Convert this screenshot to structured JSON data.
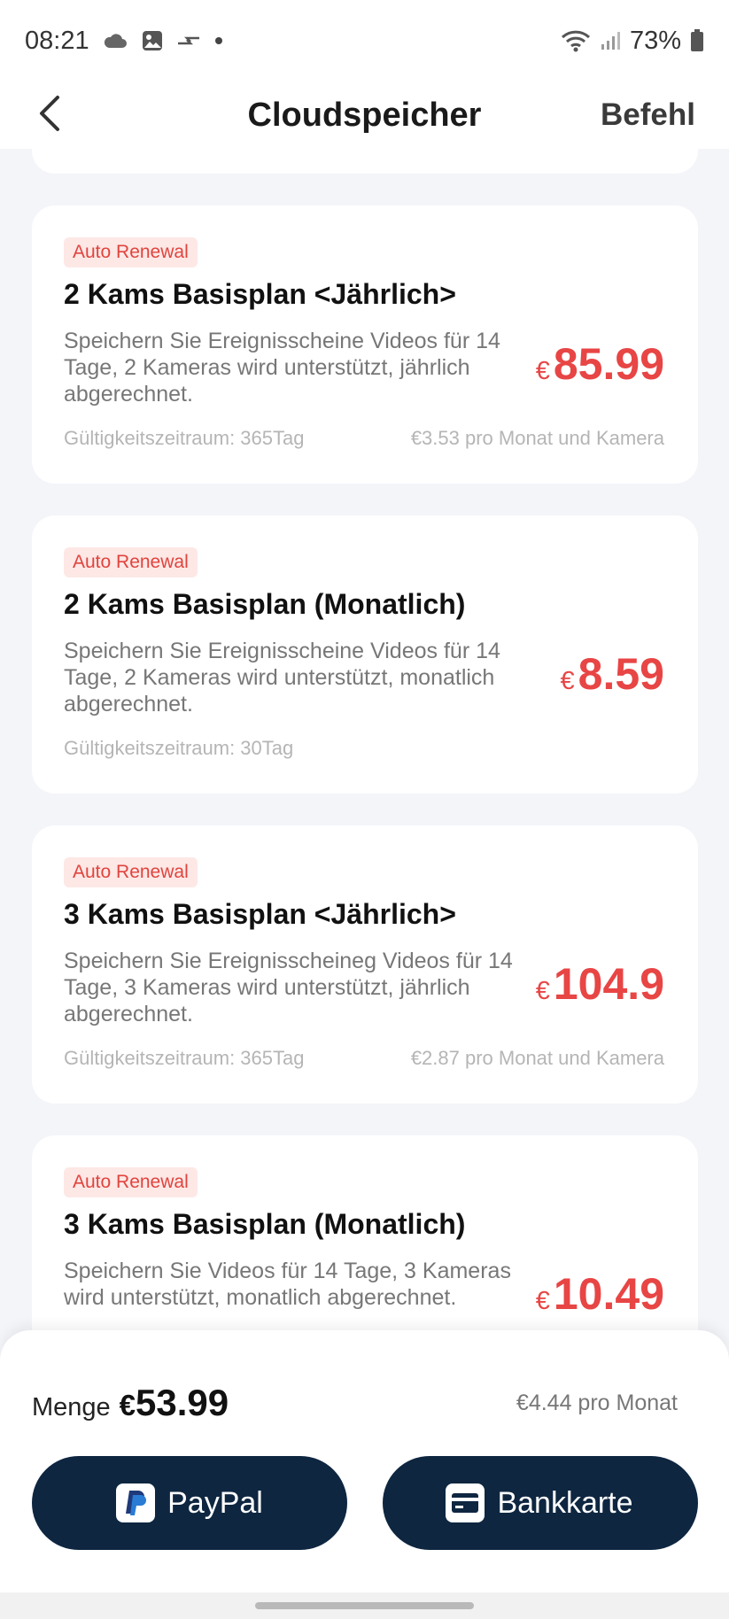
{
  "status_bar": {
    "time": "08:21",
    "battery": "73%",
    "icons_left": [
      "cloud-icon",
      "gallery-icon",
      "data-transfer-icon",
      "dot-icon"
    ],
    "icons_right": [
      "wifi-icon",
      "signal-icon",
      "battery-icon"
    ]
  },
  "header": {
    "title": "Cloudspeicher",
    "action_label": "Befehl",
    "back_icon": "chevron-left-icon"
  },
  "plans": [
    {
      "badge": "Auto Renewal",
      "title": "2 Kams Basisplan <Jährlich>",
      "description": "Speichern Sie Ereignisscheine Videos für 14 Tage, 2 Kameras wird unterstützt, jährlich abgerechnet.",
      "currency": "€",
      "price": "85.99",
      "validity": "Gültigkeitszeitraum: 365Tag",
      "per_month": "€3.53 pro Monat und Kamera"
    },
    {
      "badge": "Auto Renewal",
      "title": "2 Kams Basisplan (Monatlich)",
      "description": "Speichern Sie Ereignisscheine Videos für 14 Tage, 2 Kameras wird unterstützt, monatlich abgerechnet.",
      "currency": "€",
      "price": "8.59",
      "validity": "Gültigkeitszeitraum: 30Tag",
      "per_month": ""
    },
    {
      "badge": "Auto Renewal",
      "title": "3 Kams Basisplan <Jährlich>",
      "description": "Speichern Sie Ereignisscheineg Videos für 14 Tage, 3 Kameras wird unterstützt, jährlich abgerechnet.",
      "currency": "€",
      "price": "104.9",
      "validity": "Gültigkeitszeitraum: 365Tag",
      "per_month": "€2.87 pro Monat und Kamera"
    },
    {
      "badge": "Auto Renewal",
      "title": "3 Kams Basisplan (Monatlich)",
      "description": "Speichern Sie Videos für 14 Tage, 3 Kameras wird unterstützt, monatlich abgerechnet.",
      "currency": "€",
      "price": "10.49",
      "validity": "",
      "per_month": ""
    }
  ],
  "footer": {
    "total_label": "Menge",
    "total_currency": "€",
    "total_amount": "53.99",
    "per_month": "€4.44 pro Monat",
    "paypal_label": "PayPal",
    "card_label": "Bankkarte"
  },
  "colors": {
    "accent_price": "#e84545",
    "badge_bg": "#fde8e6",
    "button_bg": "#0e2640",
    "page_bg": "#f4f5f9"
  }
}
